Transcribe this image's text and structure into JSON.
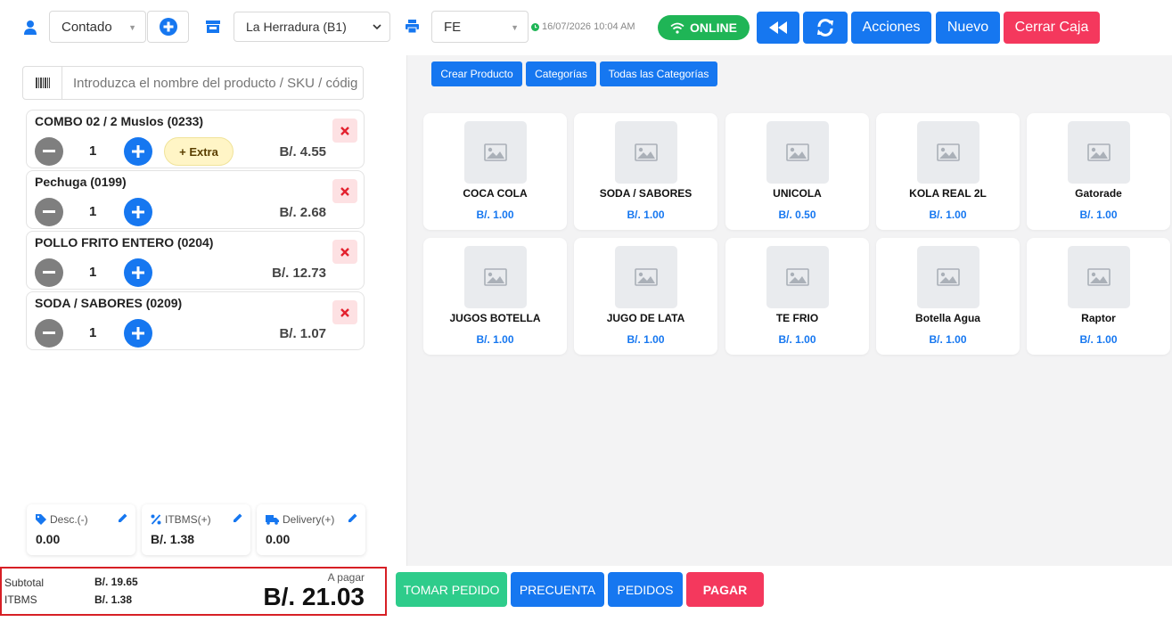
{
  "topbar": {
    "customer_select": "Contado",
    "store_select": "La Herradura (B1)",
    "doc_type_select": "FE",
    "datetime": "16/07/2026 10:04 AM",
    "online_label": "ONLINE",
    "acciones_label": "Acciones",
    "nuevo_label": "Nuevo",
    "cerrar_caja_label": "Cerrar Caja"
  },
  "search": {
    "placeholder": "Introduzca el nombre del producto / SKU / código"
  },
  "cart": {
    "items": [
      {
        "name": "COMBO 02 / 2 Muslos (0233)",
        "qty": "1",
        "price": "B/. 4.55",
        "extra_label": "+ Extra"
      },
      {
        "name": "Pechuga (0199)",
        "qty": "1",
        "price": "B/. 2.68"
      },
      {
        "name": "POLLO FRITO ENTERO (0204)",
        "qty": "1",
        "price": "B/. 12.73"
      },
      {
        "name": "SODA / SABORES (0209)",
        "qty": "1",
        "price": "B/. 1.07"
      }
    ]
  },
  "adjustments": {
    "desc_label": "Desc.(-)",
    "desc_value": "0.00",
    "itbms_label": "ITBMS(+)",
    "itbms_value": "B/. 1.38",
    "delivery_label": "Delivery(+)",
    "delivery_value": "0.00"
  },
  "totals": {
    "subtotal_label": "Subtotal",
    "subtotal_value": "B/. 19.65",
    "itbms_label": "ITBMS",
    "itbms_value": "B/. 1.38",
    "apagar_label": "A pagar",
    "total_value": "B/. 21.03"
  },
  "actions": {
    "tomar_pedido": "TOMAR PEDIDO",
    "precuenta": "PRECUENTA",
    "pedidos": "PEDIDOS",
    "pagar": "PAGAR"
  },
  "category_buttons": {
    "crear_producto": "Crear Producto",
    "categorias": "Categorías",
    "todas": "Todas las Categorías"
  },
  "products": [
    {
      "name": "COCA COLA",
      "price": "B/. 1.00"
    },
    {
      "name": "SODA / SABORES",
      "price": "B/. 1.00"
    },
    {
      "name": "UNICOLA",
      "price": "B/. 0.50"
    },
    {
      "name": "KOLA REAL 2L",
      "price": "B/. 1.00"
    },
    {
      "name": "Gatorade",
      "price": "B/. 1.00"
    },
    {
      "name": "JUGOS BOTELLA",
      "price": "B/. 1.00"
    },
    {
      "name": "JUGO DE LATA",
      "price": "B/. 1.00"
    },
    {
      "name": "TE FRIO",
      "price": "B/. 1.00"
    },
    {
      "name": "Botella Agua",
      "price": "B/. 1.00"
    },
    {
      "name": "Raptor",
      "price": "B/. 1.00"
    }
  ],
  "colors": {
    "primary": "#1677f0",
    "danger": "#f4385d",
    "success": "#1fb556",
    "tomar_pedido": "#2ecc8b"
  }
}
